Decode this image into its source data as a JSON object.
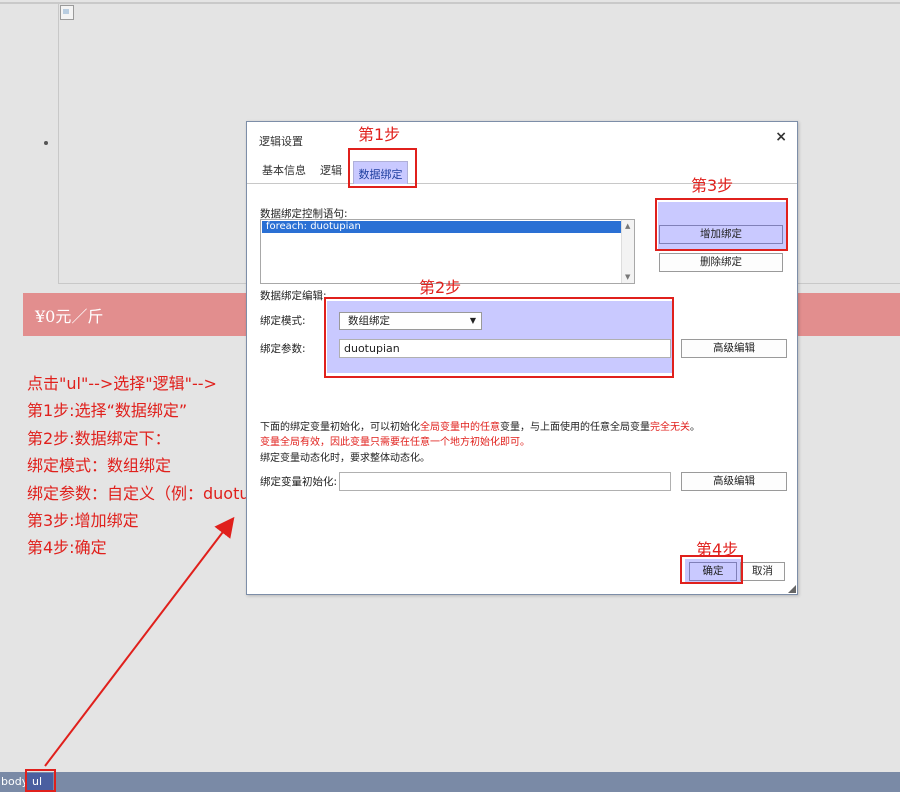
{
  "page": {
    "price_text": "¥0元／斤"
  },
  "instructions": [
    "点击\"ul\"-->选择\"逻辑\"-->",
    "第1步:选择“数据绑定”",
    "第2步:数据绑定下：",
    "绑定模式：数组绑定",
    "绑定参数：自定义（例：duotupian）",
    "第3步:增加绑定",
    "第4步:确定"
  ],
  "statusbar": {
    "body_label": "body",
    "ul_label": "ul"
  },
  "dialog": {
    "title": "逻辑设置",
    "close_glyph": "×",
    "tabs": [
      "基本信息",
      "逻辑",
      "数据绑定"
    ],
    "binding_statement_label": "数据绑定控制语句:",
    "binding_list": [
      "foreach: duotupian"
    ],
    "add_binding_label": "增加绑定",
    "delete_binding_label": "删除绑定",
    "binding_edit_label": "数据绑定编辑:",
    "mode_label": "绑定模式:",
    "mode_value": "数组绑定",
    "param_label": "绑定参数:",
    "param_value": "duotupian",
    "advanced_edit_label": "高级编辑",
    "note_line1_parts": [
      "下面的绑定变量初始化，可以初始化",
      "全局变量中的任意",
      "变量，与上面使用的任意全局变量",
      "完全无关",
      "。"
    ],
    "note_line2": "变量全局有效，因此变量只需要在任意一个地方初始化即可。",
    "note_line3": "绑定变量动态化时，要求整体动态化。",
    "init_label": "绑定变量初始化:",
    "init_value": "",
    "init_advanced_label": "高级编辑",
    "ok_label": "确定",
    "cancel_label": "取消"
  },
  "annotations": {
    "step1": "第1步",
    "step2": "第2步",
    "step3": "第3步",
    "step4": "第4步"
  },
  "colors": {
    "annotation_red": "#e0201c",
    "highlight_blue": "#c9c9ff",
    "price_band": "#e28e8e",
    "statusbar": "#7a8aa6"
  },
  "icons": [
    "broken-image-icon",
    "close-icon",
    "dropdown-arrow-icon",
    "resize-grip-icon"
  ]
}
